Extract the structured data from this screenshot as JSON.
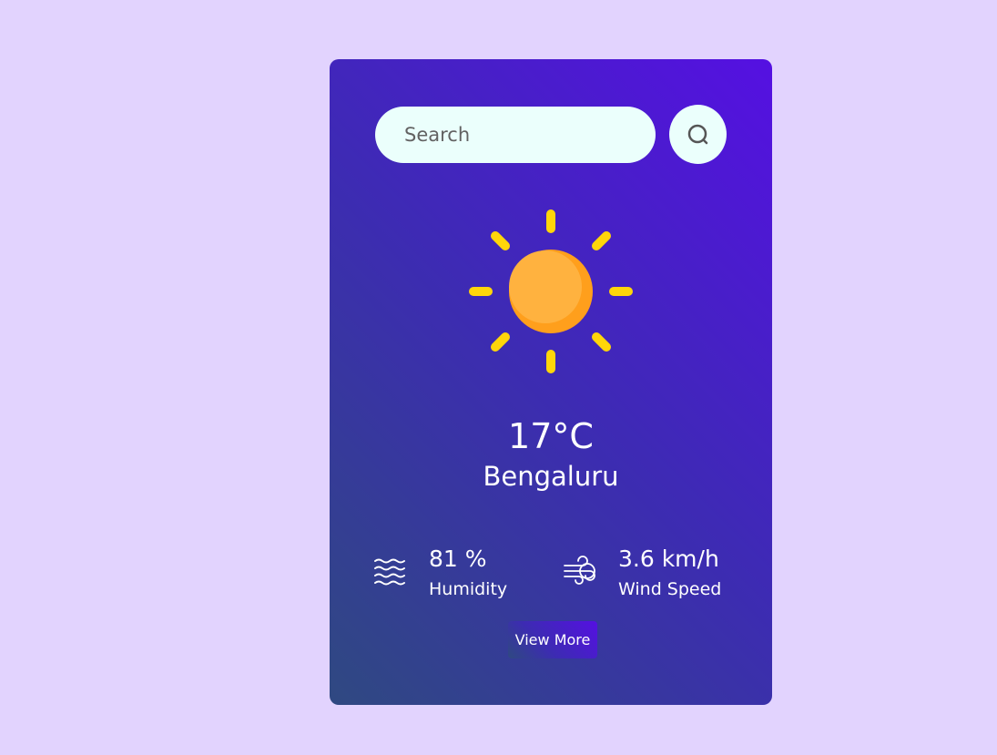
{
  "search": {
    "placeholder": "Search",
    "value": "",
    "button_icon": "search-icon"
  },
  "weather": {
    "icon": "sun-icon",
    "temperature": "17°C",
    "city": "Bengaluru"
  },
  "details": {
    "humidity": {
      "icon": "humidity-waves-icon",
      "value": "81 %",
      "label": "Humidity"
    },
    "wind": {
      "icon": "wind-icon",
      "value": "3.6 km/h",
      "label": "Wind Speed"
    }
  },
  "actions": {
    "view_more_label": "View More"
  },
  "colors": {
    "page_background": "#e2d3fe",
    "card_gradient_start": "#5510e2",
    "card_gradient_end": "#2f4981",
    "input_background": "#ebfffc",
    "sun_core": "#ffad3b",
    "sun_rays": "#ffd60a"
  }
}
